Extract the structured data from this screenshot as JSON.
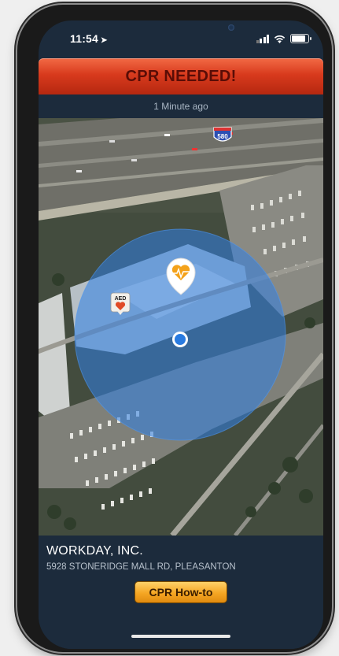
{
  "status_bar": {
    "time": "11:54",
    "location_icon": "location-arrow-icon",
    "signal_icon": "cellular-signal-icon",
    "wifi_icon": "wifi-icon",
    "battery_icon": "battery-icon"
  },
  "alert": {
    "title": "CPR NEEDED!",
    "time_ago": "1 Minute ago"
  },
  "map": {
    "highway_shield": "580",
    "aed_label": "AED",
    "radius_color": "#2f7fe6",
    "user_dot_color": "#2a7be0",
    "incident_icon": "heart-pulse-pin-icon"
  },
  "location": {
    "name": "WORKDAY, INC.",
    "address": "5928 STONERIDGE MALL RD, PLEASANTON"
  },
  "actions": {
    "cpr_howto_label": "CPR How-to"
  },
  "colors": {
    "banner_red": "#d83a1d",
    "panel_navy": "#1c2b3c",
    "button_orange": "#f5a623"
  }
}
